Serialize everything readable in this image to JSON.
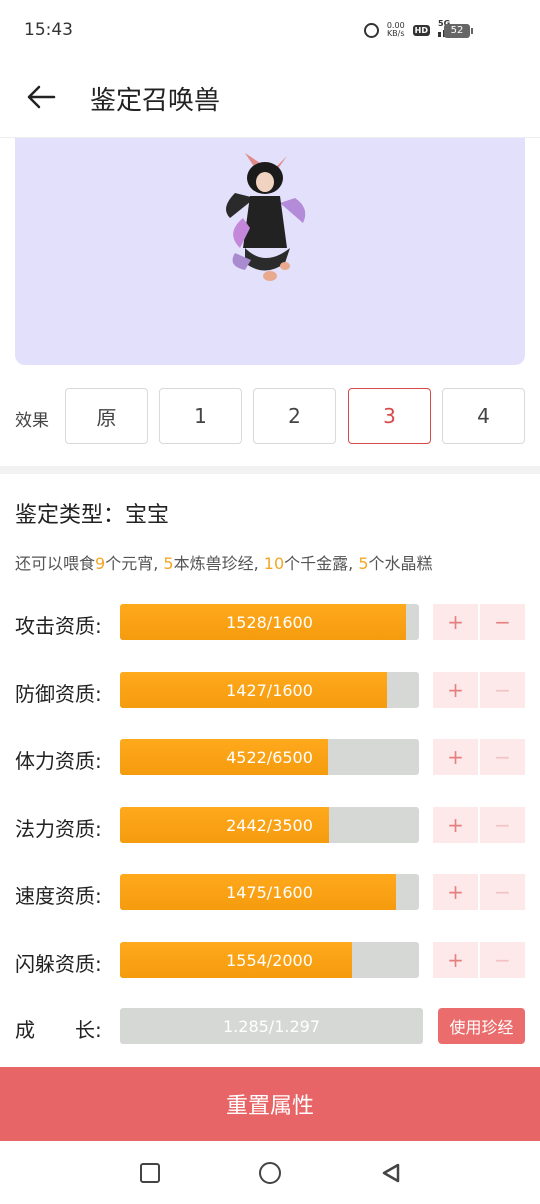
{
  "status": {
    "time": "15:43",
    "net_speed_top": "0.00",
    "net_speed_bottom": "KB/s",
    "hd": "HD",
    "network": "5G",
    "battery": "52"
  },
  "header": {
    "title": "鉴定召唤兽",
    "back_icon": "arrow-left-icon"
  },
  "effects": {
    "label": "效果",
    "options": [
      "原",
      "1",
      "2",
      "3",
      "4"
    ],
    "selected": "3"
  },
  "appraisal": {
    "type_label": "鉴定类型：",
    "type_value": "宝宝",
    "feed": {
      "prefix": "还可以喂食",
      "n1": "9",
      "t1": "个元宵, ",
      "n2": "5",
      "t2": "本炼兽珍经, ",
      "n3": "10",
      "t3": "个千金露, ",
      "n4": "5",
      "t4": "个水晶糕"
    }
  },
  "attributes": [
    {
      "label": "攻击资质:",
      "text": "1528/1600",
      "value": 1528,
      "max": 1600,
      "plus": "+",
      "minus": "−",
      "minus_enabled": true
    },
    {
      "label": "防御资质:",
      "text": "1427/1600",
      "value": 1427,
      "max": 1600,
      "plus": "+",
      "minus": "−",
      "minus_enabled": false
    },
    {
      "label": "体力资质:",
      "text": "4522/6500",
      "value": 4522,
      "max": 6500,
      "plus": "+",
      "minus": "−",
      "minus_enabled": false
    },
    {
      "label": "法力资质:",
      "text": "2442/3500",
      "value": 2442,
      "max": 3500,
      "plus": "+",
      "minus": "−",
      "minus_enabled": false
    },
    {
      "label": "速度资质:",
      "text": "1475/1600",
      "value": 1475,
      "max": 1600,
      "plus": "+",
      "minus": "−",
      "minus_enabled": false
    },
    {
      "label": "闪躲资质:",
      "text": "1554/2000",
      "value": 1554,
      "max": 2000,
      "plus": "+",
      "minus": "−",
      "minus_enabled": false
    }
  ],
  "growth": {
    "label_a": "成",
    "label_b": "长:",
    "text": "1.285/1.297",
    "button": "使用珍经"
  },
  "reset_button": "重置属性",
  "colors": {
    "accent": "#e86567",
    "bar_fill": "#ffa91c",
    "highlight": "#f5a623",
    "preview_bg": "#e3e0fc"
  }
}
